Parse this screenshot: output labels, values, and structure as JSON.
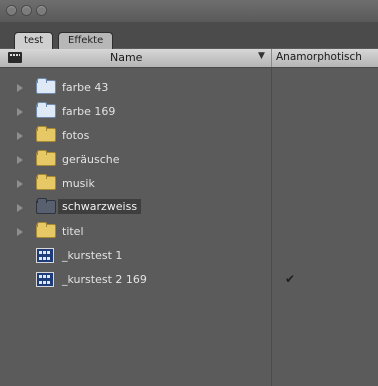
{
  "tabs": [
    {
      "label": "test",
      "active": true
    },
    {
      "label": "Effekte",
      "active": false
    }
  ],
  "columns": {
    "name": "Name",
    "anamorphic": "Anamorphotisch"
  },
  "rows": [
    {
      "name": "farbe 43",
      "icon": "folder-blue-icon",
      "expandable": true
    },
    {
      "name": "farbe 169",
      "icon": "folder-blue-icon",
      "expandable": true
    },
    {
      "name": "fotos",
      "icon": "folder-icon",
      "expandable": true
    },
    {
      "name": "geräusche",
      "icon": "folder-icon",
      "expandable": true
    },
    {
      "name": "musik",
      "icon": "folder-icon",
      "expandable": true
    },
    {
      "name": "schwarzweiss",
      "icon": "folder-dark-icon",
      "expandable": true,
      "selected": true
    },
    {
      "name": "titel",
      "icon": "folder-icon",
      "expandable": true
    },
    {
      "name": "_kurstest 1",
      "icon": "sequence-icon",
      "expandable": false
    },
    {
      "name": "_kurstest 2 169",
      "icon": "sequence-icon",
      "expandable": false,
      "anamorphic": "✔"
    }
  ],
  "colors": {
    "background": "#5b5b5b",
    "header": "#c8c8c8",
    "selection": "#3e3e3e"
  }
}
